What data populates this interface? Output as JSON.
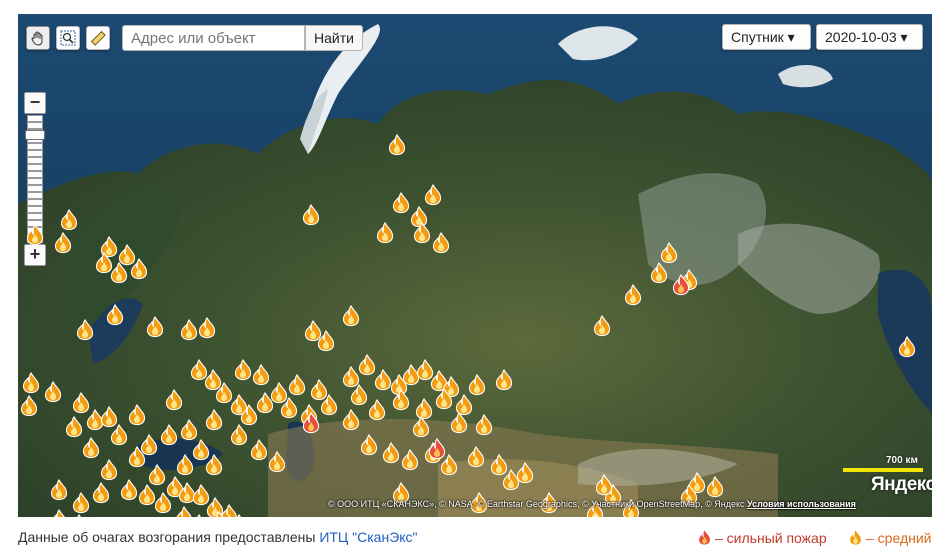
{
  "toolbar": {
    "search_placeholder": "Адрес или объект",
    "find_label": "Найти",
    "layer_label": "Спутник ▾",
    "date_label": "2020-10-03 ▾",
    "tools": [
      "hand-icon",
      "zoom-area-icon",
      "ruler-icon"
    ]
  },
  "zoom": {
    "in_label": "+",
    "out_label": "−"
  },
  "map": {
    "copyright": "© ООО ИТЦ «СКАНЭКС», © NASA, © Earthstar Geographics, © Участники OpenStreetMap, © Яндекс",
    "terms_label": "Условия использования",
    "scale_label": "700 км",
    "brand": "Яндекс",
    "fire_colors": {
      "medium": "#f39c12",
      "strong": "#e74c3c"
    }
  },
  "footer": {
    "source_prefix": "Данные об очагах возгорания предоставлены ",
    "source_link": "ИТЦ \"СканЭкс\"",
    "legend_strong": "– сильный пожар",
    "legend_medium": "– средний"
  }
}
